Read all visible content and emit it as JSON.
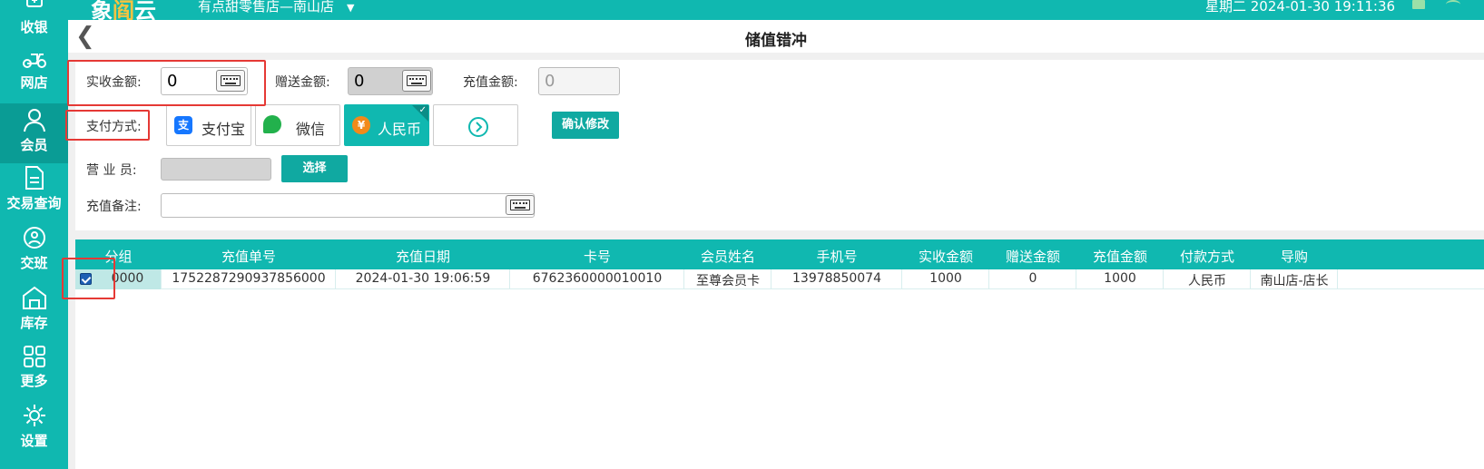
{
  "topbar": {
    "logo_part1": "象",
    "logo_part2": "阎",
    "logo_part3": "云",
    "store_name": "有点甜零售店—南山店",
    "datetime": "星期二 2024-01-30 19:11:36"
  },
  "sidebar": {
    "items": [
      {
        "label": "收银",
        "icon": "cashier-icon"
      },
      {
        "label": "网店",
        "icon": "delivery-icon"
      },
      {
        "label": "会员",
        "icon": "member-icon",
        "active": true
      },
      {
        "label": "交易查询",
        "icon": "document-icon"
      },
      {
        "label": "交班",
        "icon": "shift-icon"
      },
      {
        "label": "库存",
        "icon": "warehouse-icon"
      },
      {
        "label": "更多",
        "icon": "grid-icon"
      },
      {
        "label": "设置",
        "icon": "gear-icon"
      }
    ]
  },
  "page": {
    "title": "储值错冲",
    "back_icon": "chevron-left-icon"
  },
  "form": {
    "actual_amount_label": "实收金额:",
    "actual_amount_value": "0",
    "gift_amount_label": "赠送金额:",
    "gift_amount_value": "0",
    "recharge_amount_label": "充值金额:",
    "recharge_amount_value": "0",
    "payment_label": "支付方式:",
    "payment_methods": [
      {
        "label": "支付宝",
        "icon": "alipay-icon",
        "color": "#1677ff"
      },
      {
        "label": "微信",
        "icon": "wechat-icon",
        "color": "#22b14c"
      },
      {
        "label": "人民币",
        "icon": "rmb-icon",
        "color": "#f28a1a",
        "selected": true
      }
    ],
    "more_icon": "chevron-circle-right-icon",
    "confirm_label": "确认修改",
    "staff_label": "营 业 员:",
    "select_label": "选择",
    "remark_label": "充值备注:"
  },
  "table": {
    "headers": [
      "分组",
      "充值单号",
      "充值日期",
      "卡号",
      "会员姓名",
      "手机号",
      "实收金额",
      "赠送金额",
      "充值金额",
      "付款方式",
      "导购"
    ],
    "rows": [
      [
        "0000",
        "1752287290937856000",
        "2024-01-30 19:06:59",
        "6762360000010010",
        "至尊会员卡",
        "13978850074",
        "1000",
        "0",
        "1000",
        "人民币",
        "南山店-店长"
      ]
    ]
  },
  "colors": {
    "brand": "#10b8b0",
    "highlight": "#e53935"
  }
}
